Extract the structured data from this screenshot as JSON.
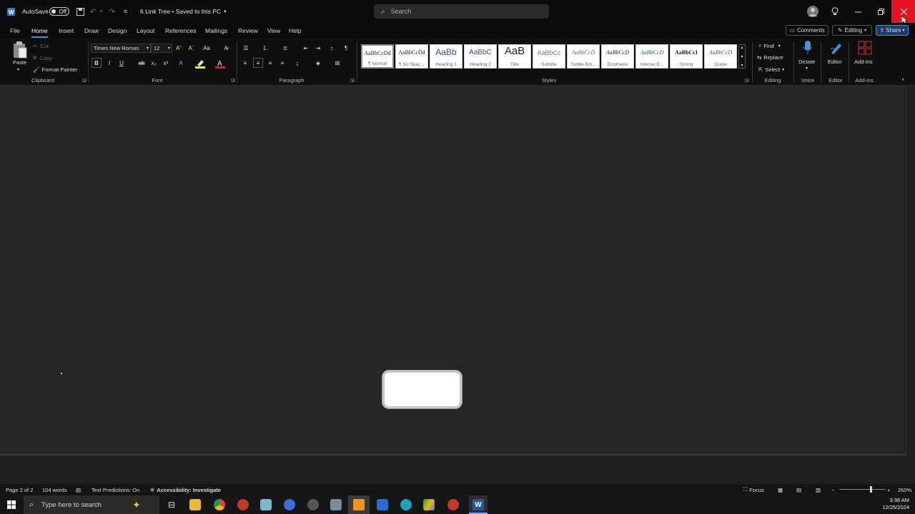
{
  "titlebar": {
    "autosave_label": "AutoSave",
    "autosave_state": "Off",
    "doc_title": "6 Link Tree • Saved to this PC",
    "search_placeholder": "Search"
  },
  "menu": {
    "tabs": [
      "File",
      "Home",
      "Insert",
      "Draw",
      "Design",
      "Layout",
      "References",
      "Mailings",
      "Review",
      "View",
      "Help"
    ],
    "active_tab": "Home",
    "comments_label": "Comments",
    "editing_label": "Editing",
    "share_label": "Share"
  },
  "ribbon": {
    "clipboard": {
      "paste": "Paste",
      "cut": "Cut",
      "copy": "Copy",
      "format_painter": "Format Painter",
      "label": "Clipboard"
    },
    "font": {
      "family": "Times New Roman",
      "size": "12",
      "label": "Font"
    },
    "paragraph": {
      "label": "Paragraph"
    },
    "styles": {
      "label": "Styles",
      "items": [
        {
          "sample": "AaBbCcDd",
          "name": "¶ Normal"
        },
        {
          "sample": "AaBbCcDd",
          "name": "¶ No Spac..."
        },
        {
          "sample": "AaBb",
          "name": "Heading 1"
        },
        {
          "sample": "AaBbC",
          "name": "Heading 2"
        },
        {
          "sample": "AaB",
          "name": "Title"
        },
        {
          "sample": "AaBbCc",
          "name": "Subtitle"
        },
        {
          "sample": "AaBbCcD",
          "name": "Subtle Em..."
        },
        {
          "sample": "AaBbCcD",
          "name": "Emphasis"
        },
        {
          "sample": "AaBbCcD",
          "name": "Intense E..."
        },
        {
          "sample": "AaBbCcI",
          "name": "Strong"
        },
        {
          "sample": "AaBbCcD",
          "name": "Quote"
        }
      ]
    },
    "editing": {
      "find": "Find",
      "replace": "Replace",
      "select": "Select",
      "label": "Editing"
    },
    "voice": {
      "dictate": "Dictate",
      "label": "Voice"
    },
    "editor": {
      "editor": "Editor",
      "label": "Editor"
    },
    "addins": {
      "addins": "Add-ins",
      "label": "Add-ins"
    }
  },
  "statusbar": {
    "page": "Page 2 of 2",
    "words": "104 words",
    "text_predictions": "Text Predictions: On",
    "accessibility": "Accessibility: Investigate",
    "focus": "Focus",
    "zoom": "260%"
  },
  "taskbar": {
    "search_placeholder": "Type here to search",
    "time": "3:38 AM",
    "date": "12/25/2024"
  },
  "colors": {
    "accent": "#4f8fdb",
    "close": "#e81123",
    "word_blue": "#2b579a"
  }
}
